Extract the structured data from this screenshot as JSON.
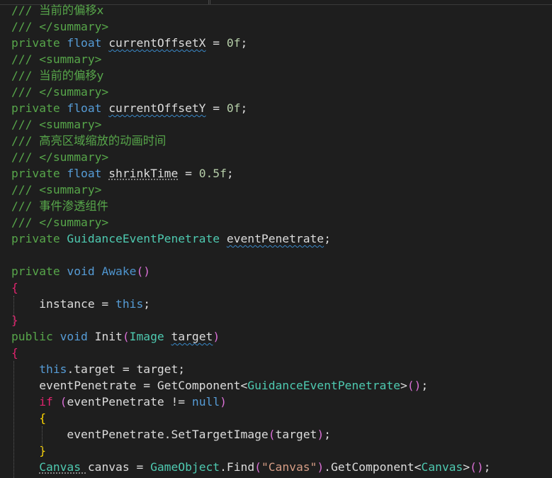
{
  "colors": {
    "background": "#1e1e1e",
    "comment": "#57a64a",
    "xml_doc": "#608b4e",
    "keyword": "#569cd6",
    "type": "#4ec9b0",
    "identifier": "#dcdcdc",
    "number": "#b5cea8",
    "string": "#d69d85",
    "method_declared": "#4e94ce",
    "paren_level1": "#da70d6",
    "paren_level2": "#ffd700",
    "brace_magenta": "#e0246e",
    "brace_yellow": "#d7ba7d"
  },
  "lines": [
    [
      {
        "t": "/// ",
        "c": "comment"
      },
      {
        "t": "当前的偏移x",
        "c": "comment",
        "f": "cjk"
      }
    ],
    [
      {
        "t": "/// </summary>",
        "c": "comment"
      }
    ],
    [
      {
        "t": "private ",
        "c": "comment"
      },
      {
        "t": "float ",
        "c": "keyword"
      },
      {
        "t": "currentOffsetX",
        "c": "identifier",
        "u": "squig"
      },
      {
        "t": " = ",
        "c": "identifier"
      },
      {
        "t": "0f",
        "c": "number"
      },
      {
        "t": ";",
        "c": "identifier"
      }
    ],
    [
      {
        "t": "/// <summary>",
        "c": "comment"
      }
    ],
    [
      {
        "t": "/// ",
        "c": "comment"
      },
      {
        "t": "当前的偏移y",
        "c": "comment",
        "f": "cjk"
      }
    ],
    [
      {
        "t": "/// </summary>",
        "c": "comment"
      }
    ],
    [
      {
        "t": "private ",
        "c": "comment"
      },
      {
        "t": "float ",
        "c": "keyword"
      },
      {
        "t": "currentOffsetY",
        "c": "identifier",
        "u": "squig"
      },
      {
        "t": " = ",
        "c": "identifier"
      },
      {
        "t": "0f",
        "c": "number"
      },
      {
        "t": ";",
        "c": "identifier"
      }
    ],
    [
      {
        "t": "/// <summary>",
        "c": "comment"
      }
    ],
    [
      {
        "t": "/// ",
        "c": "comment"
      },
      {
        "t": "高亮区域缩放的动画时间",
        "c": "comment",
        "f": "cjk"
      }
    ],
    [
      {
        "t": "/// </summary>",
        "c": "comment"
      }
    ],
    [
      {
        "t": "private ",
        "c": "comment"
      },
      {
        "t": "float ",
        "c": "keyword"
      },
      {
        "t": "shrinkTime",
        "c": "identifier",
        "u": "dotted"
      },
      {
        "t": " = ",
        "c": "identifier"
      },
      {
        "t": "0.5f",
        "c": "number"
      },
      {
        "t": ";",
        "c": "identifier"
      }
    ],
    [
      {
        "t": "/// <summary>",
        "c": "comment"
      }
    ],
    [
      {
        "t": "/// ",
        "c": "comment"
      },
      {
        "t": "事件渗透组件",
        "c": "comment",
        "f": "cjk"
      }
    ],
    [
      {
        "t": "/// </summary>",
        "c": "comment"
      }
    ],
    [
      {
        "t": "private ",
        "c": "comment"
      },
      {
        "t": "GuidanceEventPenetrate ",
        "c": "type"
      },
      {
        "t": "eventPenetrate",
        "c": "identifier",
        "u": "squig"
      },
      {
        "t": ";",
        "c": "identifier"
      }
    ],
    [],
    [
      {
        "t": "private ",
        "c": "comment"
      },
      {
        "t": "void ",
        "c": "keyword"
      },
      {
        "t": "Awake",
        "c": "method_declared"
      },
      {
        "t": "()",
        "c": "paren_level1"
      }
    ],
    [
      {
        "t": "{",
        "c": "brace_magenta"
      }
    ],
    [
      {
        "t": "    instance = ",
        "c": "identifier"
      },
      {
        "t": "this",
        "c": "keyword"
      },
      {
        "t": ";",
        "c": "identifier"
      }
    ],
    [
      {
        "t": "}",
        "c": "brace_magenta"
      }
    ],
    [
      {
        "t": "public ",
        "c": "comment"
      },
      {
        "t": "void ",
        "c": "keyword"
      },
      {
        "t": "Init",
        "c": "identifier"
      },
      {
        "t": "(",
        "c": "paren_level1"
      },
      {
        "t": "Image ",
        "c": "type"
      },
      {
        "t": "target",
        "c": "identifier",
        "u": "squig"
      },
      {
        "t": ")",
        "c": "paren_level1"
      }
    ],
    [
      {
        "t": "{",
        "c": "brace_magenta"
      }
    ],
    [
      {
        "t": "    ",
        "c": "identifier"
      },
      {
        "t": "this",
        "c": "keyword"
      },
      {
        "t": ".target = target;",
        "c": "identifier"
      }
    ],
    [
      {
        "t": "    eventPenetrate = GetComponent<",
        "c": "identifier"
      },
      {
        "t": "GuidanceEventPenetrate",
        "c": "type"
      },
      {
        "t": ">",
        "c": "identifier"
      },
      {
        "t": "()",
        "c": "paren_level1"
      },
      {
        "t": ";",
        "c": "identifier"
      }
    ],
    [
      {
        "t": "    ",
        "c": "identifier"
      },
      {
        "t": "if ",
        "c": "brace_magenta"
      },
      {
        "t": "(",
        "c": "paren_level1"
      },
      {
        "t": "eventPenetrate != ",
        "c": "identifier"
      },
      {
        "t": "null",
        "c": "keyword"
      },
      {
        "t": ")",
        "c": "paren_level1"
      }
    ],
    [
      {
        "t": "    {",
        "c": "paren_level2"
      }
    ],
    [
      {
        "t": "        eventPenetrate.SetTargetImage",
        "c": "identifier"
      },
      {
        "t": "(",
        "c": "paren_level1"
      },
      {
        "t": "target",
        "c": "identifier"
      },
      {
        "t": ")",
        "c": "paren_level1"
      },
      {
        "t": ";",
        "c": "identifier"
      }
    ],
    [
      {
        "t": "    }",
        "c": "paren_level2"
      }
    ],
    [
      {
        "t": "    ",
        "c": "identifier"
      },
      {
        "t": "Canvas ",
        "c": "type",
        "u": "dotted"
      },
      {
        "t": "canvas = ",
        "c": "identifier"
      },
      {
        "t": "GameObject",
        "c": "type"
      },
      {
        "t": ".Find",
        "c": "identifier"
      },
      {
        "t": "(",
        "c": "paren_level1"
      },
      {
        "t": "\"Canvas\"",
        "c": "string"
      },
      {
        "t": ")",
        "c": "paren_level1"
      },
      {
        "t": ".GetComponent<",
        "c": "identifier"
      },
      {
        "t": "Canvas",
        "c": "type"
      },
      {
        "t": ">",
        "c": "identifier"
      },
      {
        "t": "()",
        "c": "paren_level1"
      },
      {
        "t": ";",
        "c": "identifier"
      }
    ]
  ]
}
